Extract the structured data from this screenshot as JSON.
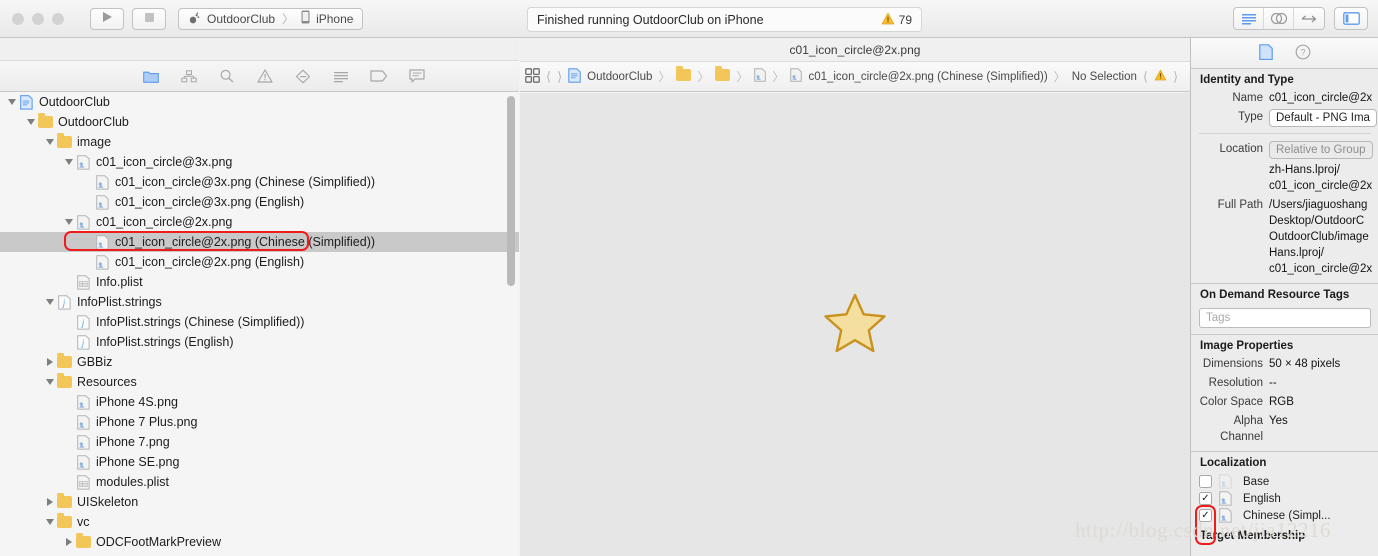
{
  "toolbar": {
    "run_icon": "play-icon",
    "stop_icon": "stop-icon",
    "scheme_name": "OutdoorClub",
    "scheme_separator": "〉",
    "destination": "iPhone",
    "status_text": "Finished running OutdoorClub on iPhone",
    "warning_count": "79",
    "warning_icon": "warning-triangle-icon",
    "right_segment": [
      "editor-standard-icon",
      "editor-assistant-icon",
      "editor-version-icon"
    ],
    "panel_toggle": [
      "inspector-toggle-icon"
    ]
  },
  "navigator": {
    "filter_icons": [
      "project-navigator-icon",
      "source-control-navigator-icon",
      "find-navigator-icon",
      "issue-navigator-icon",
      "test-navigator-icon",
      "debug-navigator-icon",
      "breakpoint-navigator-icon",
      "report-navigator-icon"
    ],
    "tree": [
      {
        "label": "OutdoorClub",
        "depth": 0,
        "state": "open",
        "icon": "xcode-project-icon"
      },
      {
        "label": "OutdoorClub",
        "depth": 1,
        "state": "open",
        "icon": "folder-icon"
      },
      {
        "label": "image",
        "depth": 2,
        "state": "open",
        "icon": "folder-icon"
      },
      {
        "label": "c01_icon_circle@3x.png",
        "depth": 3,
        "state": "open",
        "icon": "image-file-icon"
      },
      {
        "label": "c01_icon_circle@3x.png (Chinese (Simplified))",
        "depth": 4,
        "state": "none",
        "icon": "image-file-icon"
      },
      {
        "label": "c01_icon_circle@3x.png (English)",
        "depth": 4,
        "state": "none",
        "icon": "image-file-icon"
      },
      {
        "label": "c01_icon_circle@2x.png",
        "depth": 3,
        "state": "open",
        "icon": "image-file-icon"
      },
      {
        "label": "c01_icon_circle@2x.png (Chinese (Simplified))",
        "depth": 4,
        "state": "none",
        "icon": "image-file-icon",
        "selected": true,
        "highlighted": true
      },
      {
        "label": "c01_icon_circle@2x.png (English)",
        "depth": 4,
        "state": "none",
        "icon": "image-file-icon"
      },
      {
        "label": "Info.plist",
        "depth": 3,
        "state": "none",
        "icon": "plist-file-icon"
      },
      {
        "label": "InfoPlist.strings",
        "depth": 2,
        "state": "open",
        "icon": "strings-file-icon"
      },
      {
        "label": "InfoPlist.strings (Chinese (Simplified))",
        "depth": 3,
        "state": "none",
        "icon": "strings-file-icon"
      },
      {
        "label": "InfoPlist.strings (English)",
        "depth": 3,
        "state": "none",
        "icon": "strings-file-icon"
      },
      {
        "label": "GBBiz",
        "depth": 2,
        "state": "closed",
        "icon": "folder-icon"
      },
      {
        "label": "Resources",
        "depth": 2,
        "state": "open",
        "icon": "folder-icon"
      },
      {
        "label": "iPhone 4S.png",
        "depth": 3,
        "state": "none",
        "icon": "image-file-icon"
      },
      {
        "label": "iPhone 7 Plus.png",
        "depth": 3,
        "state": "none",
        "icon": "image-file-icon"
      },
      {
        "label": "iPhone 7.png",
        "depth": 3,
        "state": "none",
        "icon": "image-file-icon"
      },
      {
        "label": "iPhone SE.png",
        "depth": 3,
        "state": "none",
        "icon": "image-file-icon"
      },
      {
        "label": "modules.plist",
        "depth": 3,
        "state": "none",
        "icon": "plist-file-icon"
      },
      {
        "label": "UISkeleton",
        "depth": 2,
        "state": "closed",
        "icon": "folder-icon"
      },
      {
        "label": "vc",
        "depth": 2,
        "state": "open",
        "icon": "folder-icon"
      },
      {
        "label": "ODCFootMarkPreview",
        "depth": 3,
        "state": "closed",
        "icon": "folder-icon"
      }
    ]
  },
  "editor": {
    "title": "c01_icon_circle@2x.png",
    "jumpbar": {
      "grid_icon": "related-items-icon",
      "back_icon": "chevron-left-icon",
      "forward_icon": "chevron-right-icon",
      "separator": "〉",
      "crumbs": [
        {
          "label": "OutdoorClub",
          "icon": "xcode-project-icon"
        },
        {
          "label": "",
          "icon": "folder-icon"
        },
        {
          "label": "",
          "icon": "folder-icon"
        },
        {
          "label": "",
          "icon": "image-file-icon"
        },
        {
          "label": "c01_icon_circle@2x.png (Chinese (Simplified))",
          "icon": "image-file-icon"
        },
        {
          "label": "No Selection",
          "icon": ""
        }
      ],
      "issue_prev_icon": "chevron-left-icon",
      "issue_icon": "warning-triangle-icon",
      "issue_next_icon": "chevron-right-icon"
    },
    "preview_icon": "gold-star-image",
    "star_fill": "#f5dfa0",
    "star_stroke": "#c8921c",
    "canvas_background": "#e6e6e6"
  },
  "inspector": {
    "tabs": [
      "file-inspector-icon",
      "quick-help-icon"
    ],
    "identity": {
      "section_title": "Identity and Type",
      "name_label": "Name",
      "name_value": "c01_icon_circle@2x",
      "type_label": "Type",
      "type_value": "Default - PNG Ima",
      "location_label": "Location",
      "location_value": "Relative to Group",
      "location_path": [
        "zh-Hans.lproj/",
        "c01_icon_circle@2x"
      ],
      "full_path_label": "Full Path",
      "full_path_value": [
        "/Users/jiaguoshang",
        "Desktop/OutdoorC",
        "OutdoorClub/image",
        "Hans.lproj/",
        "c01_icon_circle@2x"
      ]
    },
    "odr": {
      "section_title": "On Demand Resource Tags",
      "tags_placeholder": "Tags",
      "tags_value": ""
    },
    "image_properties": {
      "section_title": "Image Properties",
      "rows": [
        {
          "label": "Dimensions",
          "value": "50 × 48 pixels"
        },
        {
          "label": "Resolution",
          "value": "--"
        },
        {
          "label": "Color Space",
          "value": "RGB"
        },
        {
          "label": "Alpha Channel",
          "value": "Yes"
        }
      ]
    },
    "localization": {
      "section_title": "Localization",
      "items": [
        {
          "label": "Base",
          "checked": false,
          "icon": "image-file-icon",
          "dim": true
        },
        {
          "label": "English",
          "checked": true,
          "icon": "image-file-icon",
          "dim": false
        },
        {
          "label": "Chinese (Simpl...",
          "checked": true,
          "icon": "image-file-icon",
          "dim": false
        }
      ],
      "check_glyph": "✓"
    },
    "target_membership": {
      "section_title": "Target Membership"
    }
  },
  "annotation": {
    "highlight_color": "#f01c1c"
  },
  "watermark": {
    "text": "http://blog.csdn.net/jia12216"
  }
}
